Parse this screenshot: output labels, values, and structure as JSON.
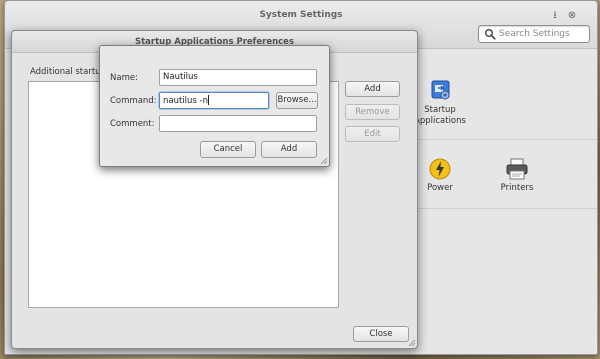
{
  "system_settings": {
    "title": "System Settings",
    "window_buttons": {
      "minimize": "⭳",
      "close": "⊗"
    },
    "search": {
      "placeholder": "Search Settings"
    },
    "apps": [
      {
        "label": "Startup Applications",
        "icon": "startup-applications-icon"
      },
      {
        "label": "Power",
        "icon": "power-icon"
      },
      {
        "label": "Printers",
        "icon": "printer-icon"
      }
    ]
  },
  "startup_prefs": {
    "title": "Startup Applications Preferences",
    "list_label": "Additional startup p",
    "buttons": {
      "add": "Add",
      "remove": "Remove",
      "edit": "Edit",
      "close": "Close"
    }
  },
  "dialog": {
    "name_label": "Name:",
    "name_value": "Nautilus",
    "command_label": "Command:",
    "command_value": "nautilus -n",
    "browse_label": "Browse...",
    "comment_label": "Comment:",
    "comment_value": "",
    "cancel_label": "Cancel",
    "add_label": "Add"
  },
  "colors": {
    "accent": "#5a8ac6",
    "power_yellow": "#f2c21b",
    "startup_blue": "#3b7dd8"
  }
}
